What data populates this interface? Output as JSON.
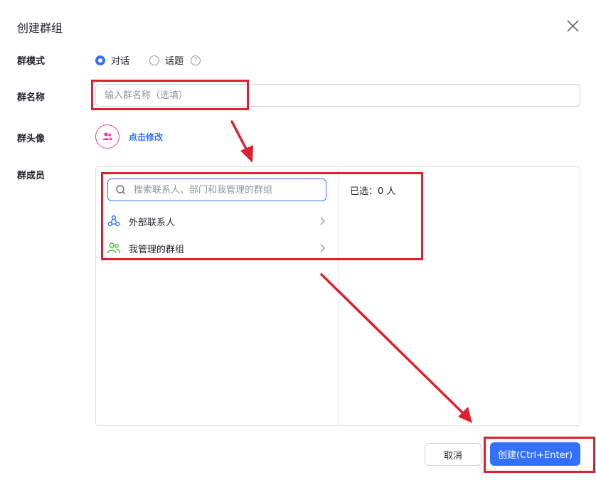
{
  "dialog": {
    "title": "创建群组"
  },
  "mode": {
    "label": "群模式",
    "options": [
      {
        "label": "对话",
        "checked": true
      },
      {
        "label": "话题",
        "checked": false
      }
    ],
    "help_icon": "question-circle-icon"
  },
  "name": {
    "label": "群名称",
    "placeholder": "输入群名称（选填）",
    "value": ""
  },
  "avatar": {
    "label": "群头像",
    "link_text": "点击修改",
    "icon": "group-people-icon"
  },
  "members": {
    "label": "群成员",
    "search_placeholder": "搜索联系人、部门和我管理的群组",
    "items": [
      {
        "label": "外部联系人",
        "icon": "external-contacts-icon"
      },
      {
        "label": "我管理的群组",
        "icon": "managed-groups-icon"
      }
    ],
    "selected_text": "已选：0 人"
  },
  "footer": {
    "cancel_label": "取消",
    "create_label": "创建(Ctrl+Enter)"
  },
  "colors": {
    "accent": "#3370ff",
    "annotation": "#e0202e",
    "avatar_pink": "#f03ba0",
    "group_green": "#34c724"
  }
}
